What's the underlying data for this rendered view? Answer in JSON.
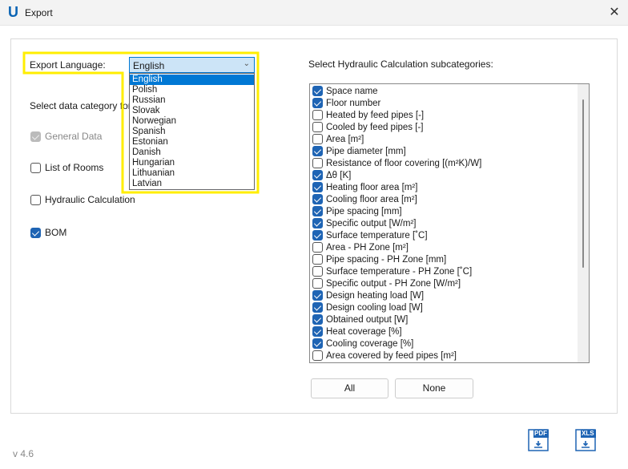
{
  "window": {
    "title": "Export",
    "logo": "U",
    "close": "✕"
  },
  "export_language": {
    "label": "Export Language:",
    "selected": "English",
    "options": [
      "English",
      "Polish",
      "Russian",
      "Slovak",
      "Norwegian",
      "Spanish",
      "Estonian",
      "Danish",
      "Hungarian",
      "Lithuanian",
      "Latvian"
    ]
  },
  "categories": {
    "label": "Select data category for e",
    "items": [
      {
        "label": "General Data",
        "checked": true,
        "disabled": true
      },
      {
        "label": "List of Rooms",
        "checked": false
      },
      {
        "label": "Hydraulic Calculation",
        "checked": false
      },
      {
        "label": "BOM",
        "checked": true
      }
    ]
  },
  "hydraulic": {
    "label": "Select Hydraulic Calculation subcategories:",
    "items": [
      {
        "label": "Space name",
        "checked": true
      },
      {
        "label": "Floor number",
        "checked": true
      },
      {
        "label": "Heated by feed pipes [-]",
        "checked": false
      },
      {
        "label": "Cooled by feed pipes [-]",
        "checked": false
      },
      {
        "label": "Area [m²]",
        "checked": false
      },
      {
        "label": "Pipe diameter [mm]",
        "checked": true
      },
      {
        "label": "Resistance of floor covering [(m²K)/W]",
        "checked": false
      },
      {
        "label": "Δθ [K]",
        "checked": true
      },
      {
        "label": "Heating floor area [m²]",
        "checked": true
      },
      {
        "label": "Cooling floor area [m²]",
        "checked": true
      },
      {
        "label": "Pipe spacing [mm]",
        "checked": true
      },
      {
        "label": "Specific output [W/m²]",
        "checked": true
      },
      {
        "label": "Surface temperature [˚C]",
        "checked": true
      },
      {
        "label": "Area - PH Zone [m²]",
        "checked": false
      },
      {
        "label": "Pipe spacing - PH Zone [mm]",
        "checked": false
      },
      {
        "label": "Surface temperature - PH Zone [˚C]",
        "checked": false
      },
      {
        "label": "Specific output - PH Zone [W/m²]",
        "checked": false
      },
      {
        "label": "Design heating load [W]",
        "checked": true
      },
      {
        "label": "Design cooling load [W]",
        "checked": true
      },
      {
        "label": "Obtained output [W]",
        "checked": true
      },
      {
        "label": "Heat coverage [%]",
        "checked": true
      },
      {
        "label": "Cooling coverage [%]",
        "checked": true
      },
      {
        "label": "Area covered by feed pipes [m²]",
        "checked": false
      }
    ],
    "all_button": "All",
    "none_button": "None"
  },
  "footer": {
    "version": "v 4.6",
    "pdf_label": "PDF",
    "xls_label": "XLS"
  },
  "colors": {
    "accent": "#0078d4",
    "highlight": "#ffee00",
    "checkbox": "#1e64b4"
  }
}
